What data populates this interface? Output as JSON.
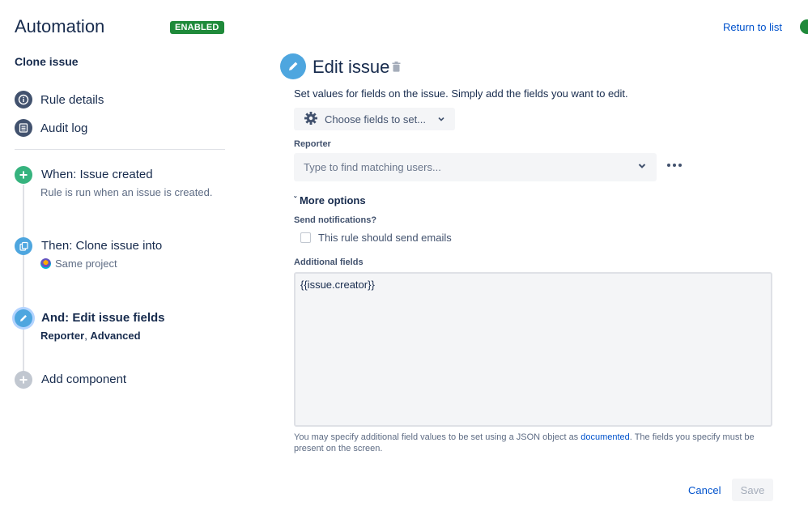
{
  "header": {
    "app_title": "Automation",
    "status_badge": "ENABLED",
    "return_link": "Return to list"
  },
  "sidebar": {
    "rule_name": "Clone issue",
    "items": [
      {
        "label": "Rule details",
        "icon": "info-icon"
      },
      {
        "label": "Audit log",
        "icon": "list-icon"
      }
    ],
    "steps": [
      {
        "title": "When: Issue created",
        "subtitle": "Rule is run when an issue is created.",
        "icon": "plus-icon",
        "color": "#36b37e"
      },
      {
        "title": "Then: Clone issue into",
        "subtitle": "Same project",
        "icon": "clone-icon",
        "color": "#4ea6df"
      },
      {
        "title": "And: Edit issue fields",
        "subtitle_a": "Reporter",
        "subtitle_sep": ", ",
        "subtitle_b": "Advanced",
        "icon": "pencil-icon",
        "color": "#4ea6df"
      },
      {
        "title": "Add component",
        "icon": "plus-icon",
        "color": "#c1c7d0"
      }
    ]
  },
  "main": {
    "title": "Edit issue",
    "description": "Set values for fields on the issue. Simply add the fields you want to edit.",
    "choose_fields_label": "Choose fields to set...",
    "reporter_label": "Reporter",
    "reporter_placeholder": "Type to find matching users...",
    "more_options_label": "More options",
    "send_notifications_label": "Send notifications?",
    "send_emails_label": "This rule should send emails",
    "additional_fields_label": "Additional fields",
    "additional_fields_value": "{{issue.creator}}",
    "help_text_before": "You may specify additional field values to be set using a JSON object as ",
    "help_link": "documented",
    "help_text_after": ". The fields you specify must be present on the screen.",
    "cancel_label": "Cancel",
    "save_label": "Save"
  },
  "colors": {
    "accent": "#0052cc",
    "enabled": "#1f8a3a",
    "step_blue": "#4ea6df",
    "step_green": "#36b37e"
  }
}
